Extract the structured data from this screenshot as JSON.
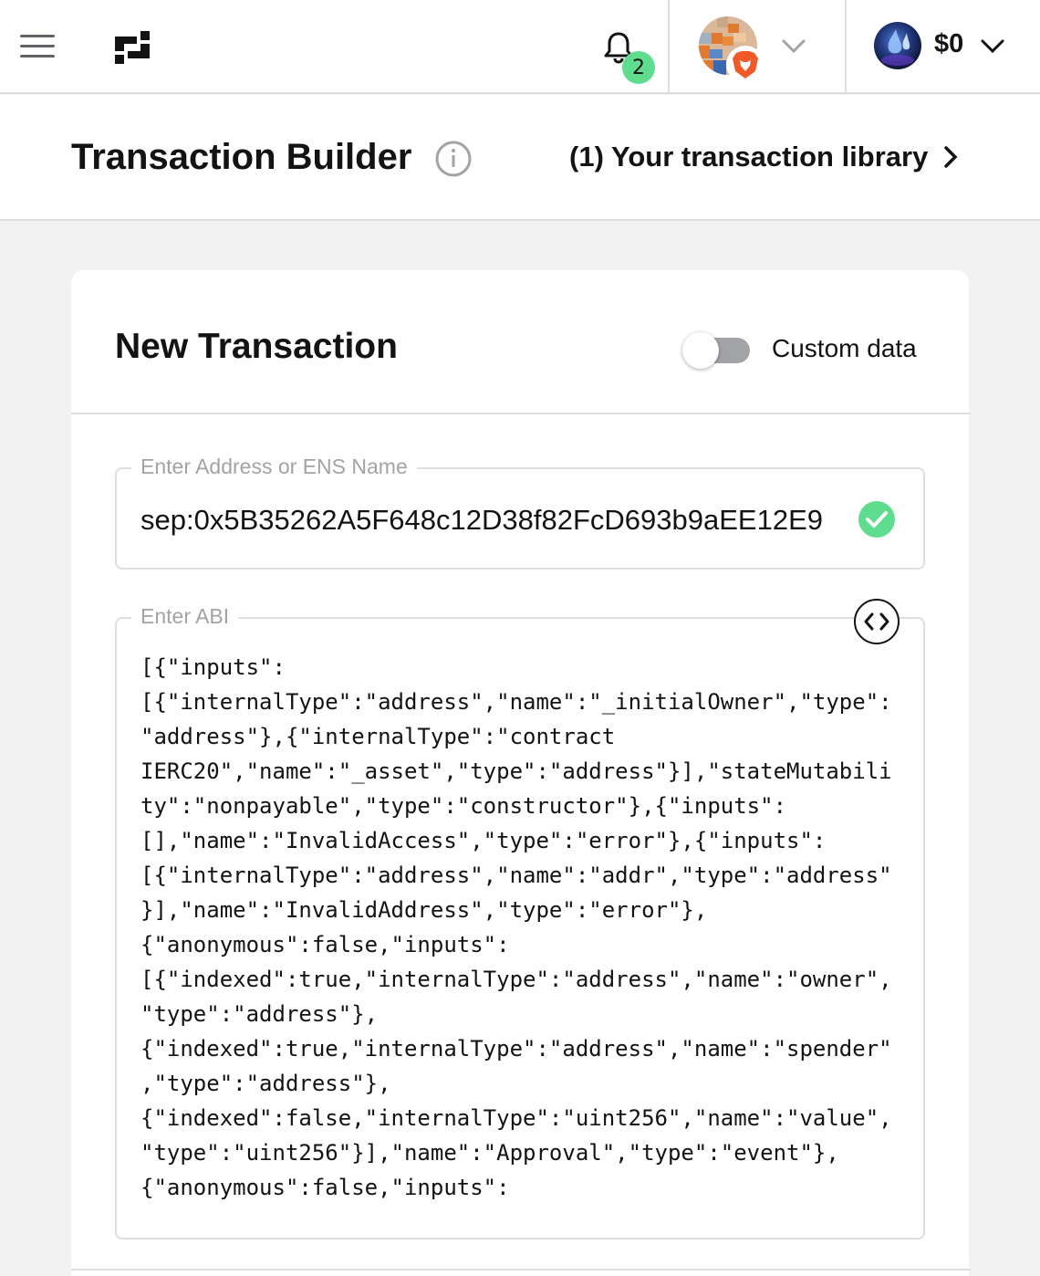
{
  "topbar": {
    "notifications_count": "2",
    "balance": "$0"
  },
  "header": {
    "title": "Transaction Builder",
    "library_link": "(1) Your transaction library"
  },
  "card": {
    "title": "New Transaction",
    "custom_data_label": "Custom data",
    "custom_data_enabled": false,
    "address_legend": "Enter Address or ENS Name",
    "address_value": "sep:0x5B35262A5F648c12D38f82FcD693b9aEE12E9",
    "abi_legend": "Enter ABI",
    "abi_value": "[{\"inputs\":\n[{\"internalType\":\"address\",\"name\":\"_initialOwner\",\"type\":\n\"address\"},{\"internalType\":\"contract\nIERC20\",\"name\":\"_asset\",\"type\":\"address\"}],\"stateMutabili\nty\":\"nonpayable\",\"type\":\"constructor\"},{\"inputs\":\n[],\"name\":\"InvalidAccess\",\"type\":\"error\"},{\"inputs\":\n[{\"internalType\":\"address\",\"name\":\"addr\",\"type\":\"address\"\n}],\"name\":\"InvalidAddress\",\"type\":\"error\"},\n{\"anonymous\":false,\"inputs\":\n[{\"indexed\":true,\"internalType\":\"address\",\"name\":\"owner\",\n\"type\":\"address\"},\n{\"indexed\":true,\"internalType\":\"address\",\"name\":\"spender\"\n,\"type\":\"address\"},\n{\"indexed\":false,\"internalType\":\"uint256\",\"name\":\"value\",\n\"type\":\"uint256\"}],\"name\":\"Approval\",\"type\":\"event\"},\n{\"anonymous\":false,\"inputs\":"
  },
  "icons": {
    "menu": "hamburger-menu-icon",
    "logo": "safe-logo-icon",
    "bell": "bell-icon",
    "avatar": "pixel-avatar-icon",
    "wallet": "brave-wallet-icon",
    "account": "account-avatar-icon",
    "info": "info-icon",
    "chevron_right": "chevron-right-icon",
    "check": "check-circle-icon",
    "code": "code-icon"
  },
  "colors": {
    "accent_green": "#5fdd8e",
    "text": "#121312",
    "muted": "#a1a3a7",
    "border": "#dcdee0",
    "background": "#f2f2f2"
  }
}
